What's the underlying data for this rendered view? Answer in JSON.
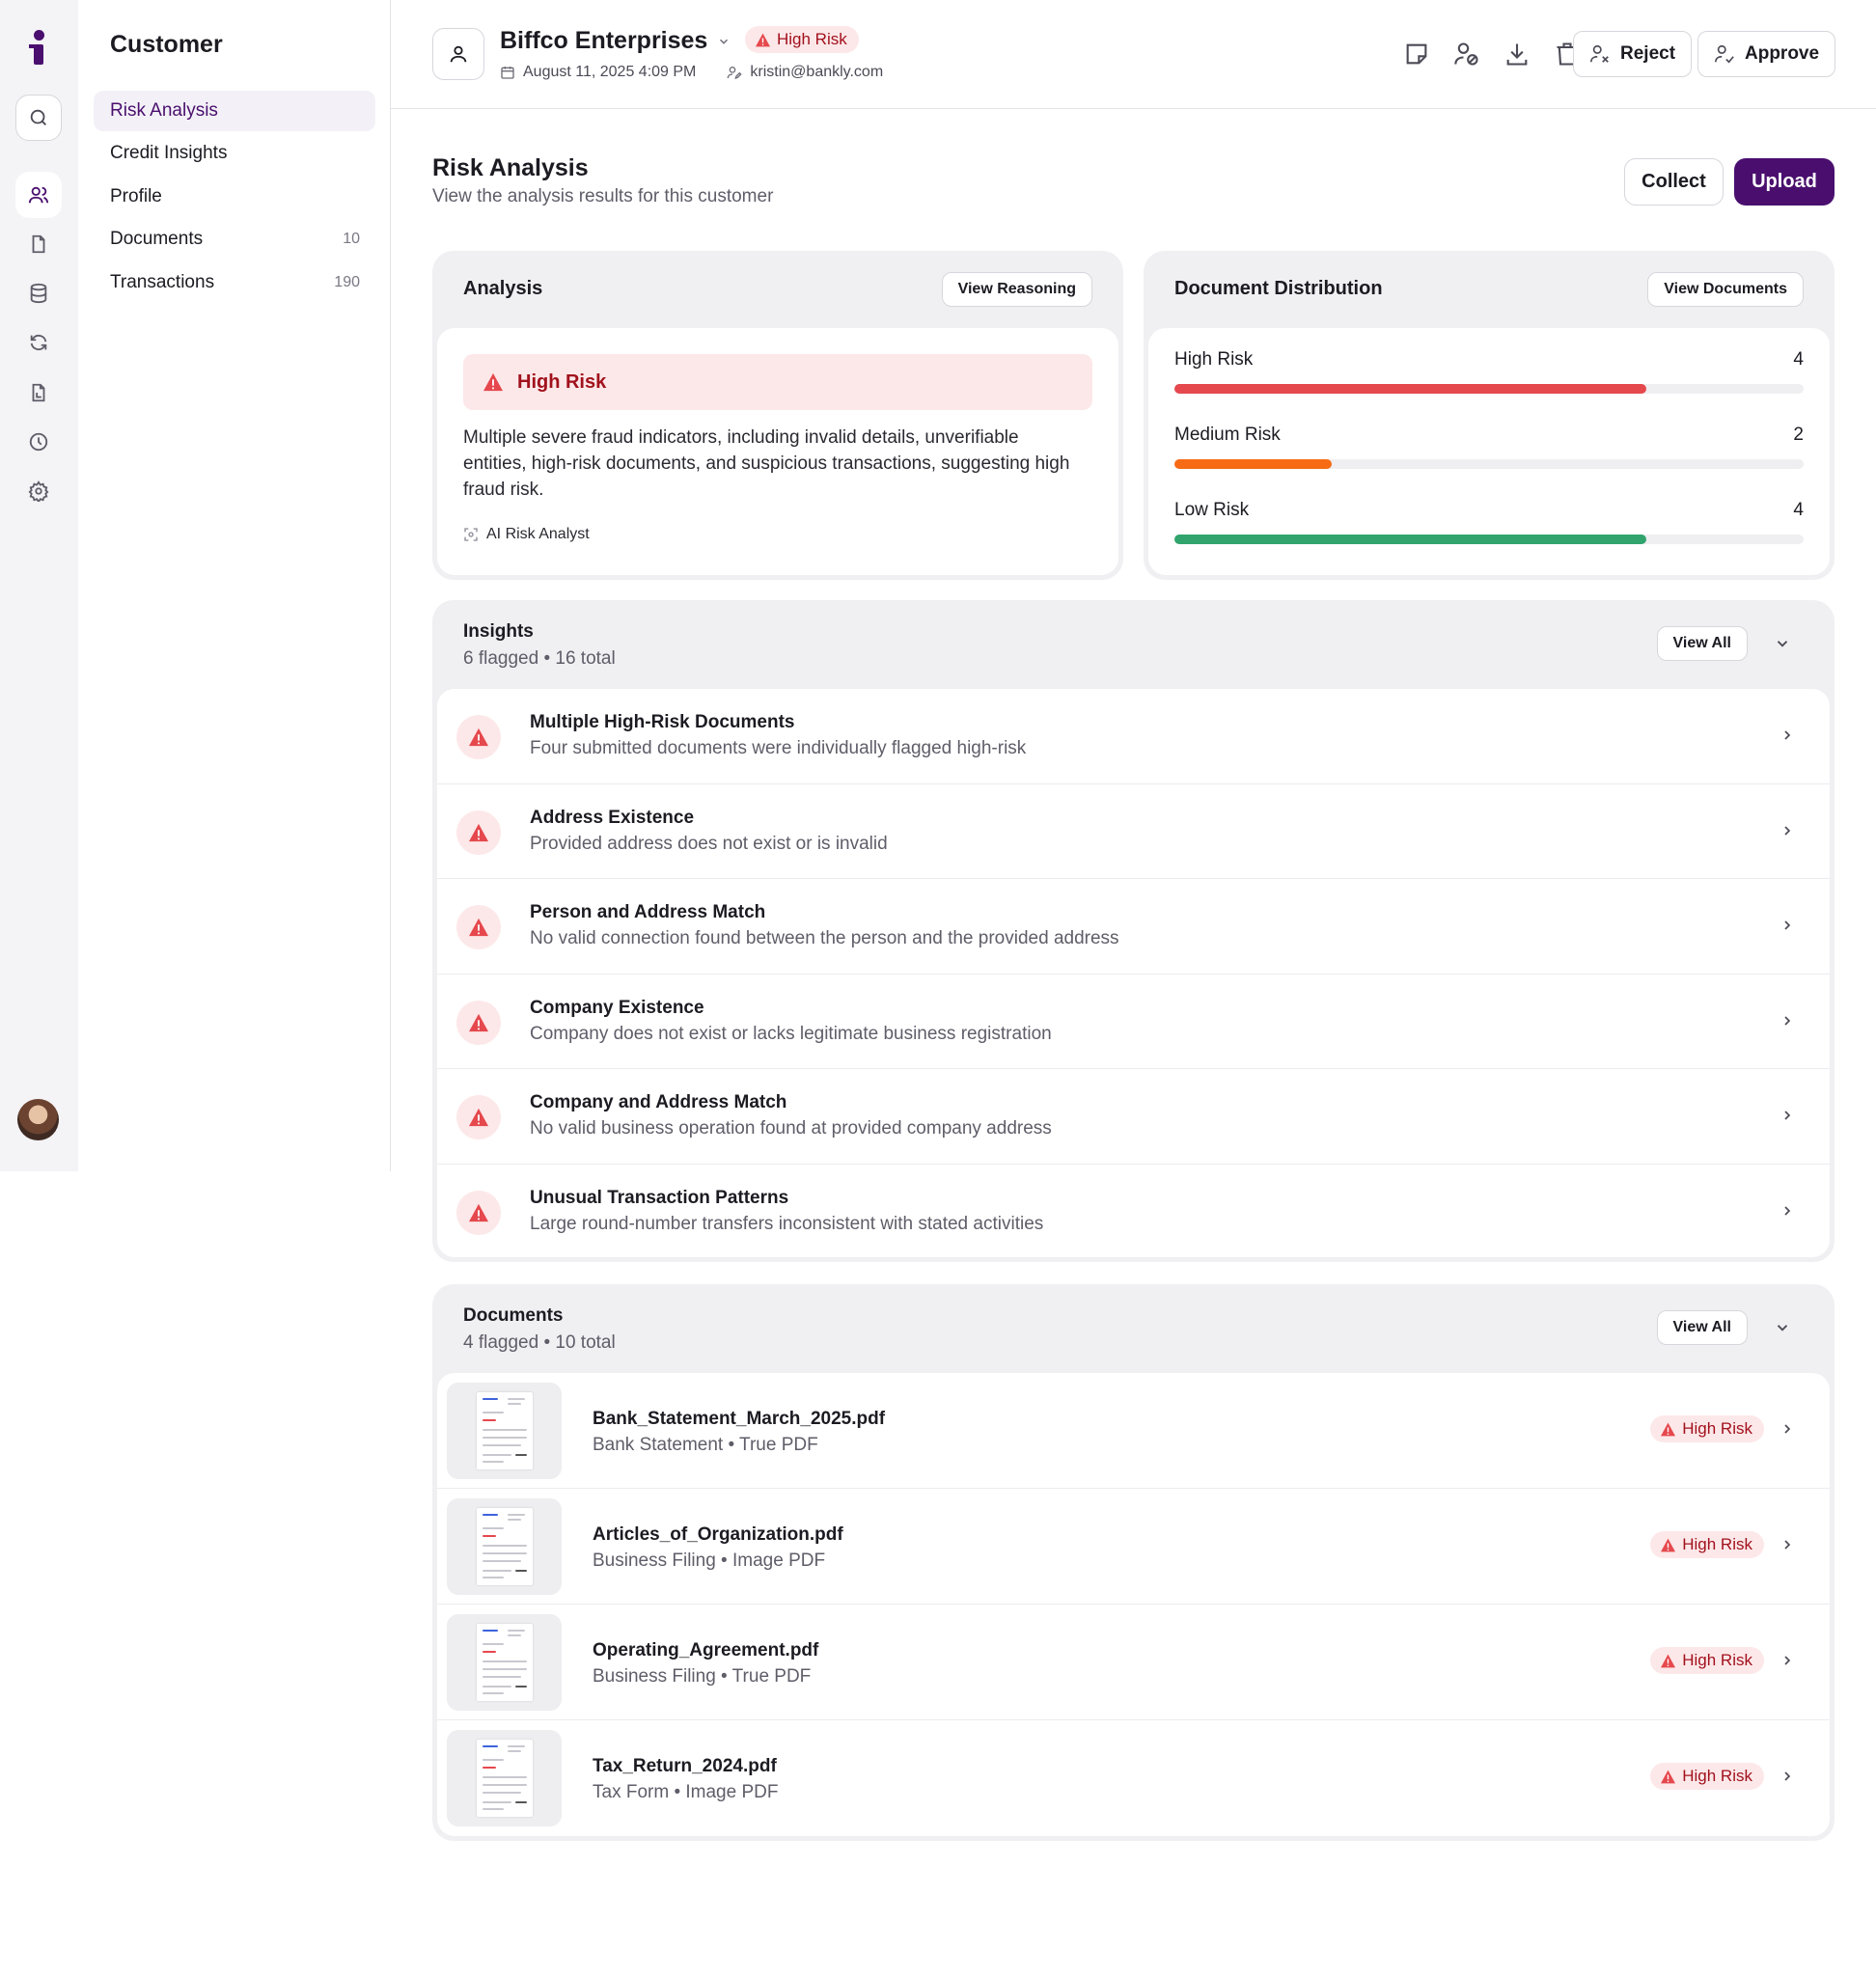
{
  "sidebar": {
    "title": "Customer",
    "items": [
      {
        "label": "Risk Analysis",
        "count": ""
      },
      {
        "label": "Credit Insights",
        "count": ""
      },
      {
        "label": "Profile",
        "count": ""
      },
      {
        "label": "Documents",
        "count": "10"
      },
      {
        "label": "Transactions",
        "count": "190"
      }
    ]
  },
  "header": {
    "customer_name": "Biffco Enterprises",
    "risk_badge": "High Risk",
    "date": "August 11, 2025 4:09 PM",
    "email": "kristin@bankly.com",
    "reject_label": "Reject",
    "approve_label": "Approve"
  },
  "page": {
    "title": "Risk Analysis",
    "subtitle": "View the analysis results for this customer",
    "collect_label": "Collect",
    "upload_label": "Upload"
  },
  "analysis": {
    "title": "Analysis",
    "button": "View Reasoning",
    "risk_level": "High Risk",
    "summary": "Multiple severe fraud indicators, including invalid details, unverifiable entities, high-risk documents, and suspicious transactions, suggesting high fraud risk.",
    "analyst": "AI Risk Analyst"
  },
  "distribution": {
    "title": "Document Distribution",
    "button": "View Documents",
    "rows": [
      {
        "label": "High Risk",
        "count": "4",
        "fraction": 0.75,
        "color": "#e5484d"
      },
      {
        "label": "Medium Risk",
        "count": "2",
        "fraction": 0.25,
        "color": "#f76b15"
      },
      {
        "label": "Low Risk",
        "count": "4",
        "fraction": 0.75,
        "color": "#30a46c"
      }
    ]
  },
  "insights": {
    "title": "Insights",
    "summary": "6 flagged • 16 total",
    "view_all": "View All",
    "items": [
      {
        "title": "Multiple High-Risk Documents",
        "desc": "Four submitted documents were individually flagged high-risk"
      },
      {
        "title": "Address Existence",
        "desc": "Provided address does not exist or is invalid"
      },
      {
        "title": "Person and Address Match",
        "desc": "No valid connection found between the person and the provided address"
      },
      {
        "title": "Company Existence",
        "desc": "Company does not exist or lacks legitimate business registration"
      },
      {
        "title": "Company and Address Match",
        "desc": "No valid business operation found at provided company address"
      },
      {
        "title": "Unusual Transaction Patterns",
        "desc": "Large round-number transfers inconsistent with stated activities"
      }
    ]
  },
  "documents": {
    "title": "Documents",
    "summary": "4 flagged • 10 total",
    "view_all": "View All",
    "items": [
      {
        "name": "Bank_Statement_March_2025.pdf",
        "meta": "Bank Statement • True PDF",
        "badge": "High Risk"
      },
      {
        "name": "Articles_of_Organization.pdf",
        "meta": "Business Filing • Image PDF",
        "badge": "High Risk"
      },
      {
        "name": "Operating_Agreement.pdf",
        "meta": "Business Filing • True PDF",
        "badge": "High Risk"
      },
      {
        "name": "Tax_Return_2024.pdf",
        "meta": "Tax Form • Image PDF",
        "badge": "High Risk"
      }
    ]
  },
  "colors": {
    "brand": "#4a0f6e",
    "danger": "#e5484d",
    "danger_bg": "#fde8e9"
  },
  "icons": {
    "rail": [
      "search-icon",
      "users-icon",
      "file-icon",
      "database-icon",
      "refresh-icon",
      "file-report-icon",
      "clock-icon",
      "gear-icon"
    ]
  }
}
